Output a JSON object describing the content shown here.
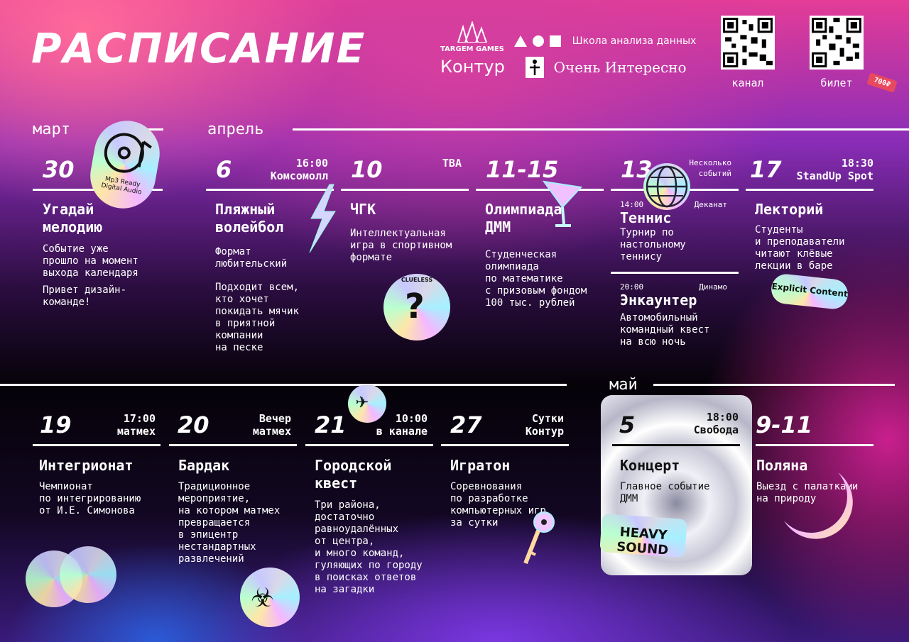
{
  "header": {
    "title": "РАСПИСАНИЕ",
    "sponsors": {
      "targem": "TARGEM GAMES",
      "kontur": "Контур",
      "shad": "Школа анализа данных",
      "interesno": "Очень Интересно"
    },
    "qr_channel_label": "канал",
    "qr_ticket_label": "билет",
    "ticket_price": "700₽"
  },
  "months": {
    "march": "март",
    "april": "апрель",
    "may": "май"
  },
  "events_row1": [
    {
      "day": "30",
      "meta": "",
      "title": "Угадай\nмелодию",
      "desc": "Событие уже\nпрошло на момент\nвыхода календаря",
      "desc2": "Привет дизайн-\nкоманде!"
    },
    {
      "day": "6",
      "meta": "16:00\nКомсомолл",
      "title": "Пляжный\nволейбол",
      "desc": "Формат\nлюбительский",
      "desc2": "Подходит всем,\nкто хочет\nпокидать мячик\nв приятной\nкомпании\nна песке"
    },
    {
      "day": "10",
      "meta": "ТВА",
      "title": "ЧГК",
      "desc": "Интеллектуальная\nигра в спортивном\nформате",
      "desc2": ""
    },
    {
      "day": "11-15",
      "meta": "",
      "title": "Олимпиада\nДММ",
      "desc": "Студенческая\nолимпиада\nпо математике\nс призовым фондом\n100 тыс. рублей",
      "desc2": ""
    },
    {
      "day": "13",
      "meta": "Несколько\nсобытий",
      "sub": [
        {
          "time": "14:00",
          "place": "Деканат",
          "title": "Теннис",
          "desc": "Турнир по\nнастольному\nтеннису"
        },
        {
          "time": "20:00",
          "place": "Динамо",
          "title": "Энкаунтер",
          "desc": "Автомобильный\nкомандный квест\nна всю ночь"
        }
      ]
    },
    {
      "day": "17",
      "meta": "18:30\nStandUp Spot",
      "title": "Лекторий",
      "desc": "Студенты\nи преподаватели\nчитают клёвые\nлекции в баре",
      "desc2": ""
    }
  ],
  "events_row2": [
    {
      "day": "19",
      "meta": "17:00\nматмех",
      "title": "Интегрионат",
      "desc": "Чемпионат\nпо интегрированию\nот И.Е. Симонова"
    },
    {
      "day": "20",
      "meta": "Вечер\nматмех",
      "title": "Бардак",
      "desc": "Традиционное\nмероприятие,\nна котором матмех\nпревращается\nв эпицентр\nнестандартных\nразвлечений"
    },
    {
      "day": "21",
      "meta": "10:00\nв канале",
      "title": "Городской\nквест",
      "desc": "Три района,\nдостаточно\nравноудалённых\nот центра,\nи много команд,\nгуляющих по городу\nв поисках ответов\nна загадки"
    },
    {
      "day": "27",
      "meta": "Сутки\nКонтур",
      "title": "Игратон",
      "desc": "Соревнования\nпо разработке\nкомпьютерных игр\nза сутки"
    },
    {
      "day": "5",
      "meta": "18:00\nСвобода",
      "title": "Концерт",
      "desc": "Главное событие\nДММ"
    },
    {
      "day": "9-11",
      "meta": "",
      "title": "Поляна",
      "desc": "Выезд с палатками\nна природу"
    }
  ],
  "stickers": {
    "mp3": "Mp3 Ready\nDigital Audio",
    "clueless": "CLUELESS",
    "explicit": "Explicit Content",
    "heavy": "HEAVY SOUND"
  }
}
